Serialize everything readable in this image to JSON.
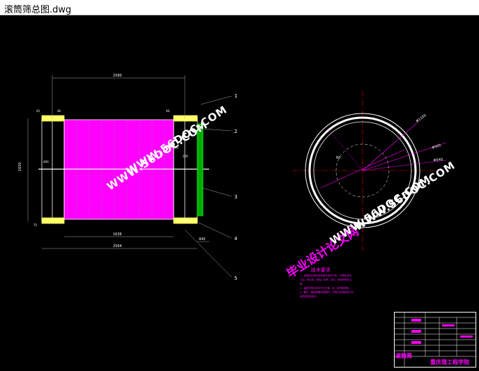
{
  "window": {
    "title": "滚筒筛总图.dwg"
  },
  "drawing": {
    "dims": {
      "top_length": "2580",
      "height": "1650",
      "inner_length": "1636",
      "overall_length": "2564",
      "right_offset": "440",
      "small_left": "46",
      "small_right": "46",
      "flange": "45",
      "left_bottom": "75",
      "mid_right": "270",
      "mid_right2": "200",
      "mid_left": "400",
      "right_side": "100"
    },
    "leaders": [
      "1",
      "2",
      "3",
      "4",
      "5"
    ],
    "section": {
      "r1": "Φ1100",
      "r2": "Φ565",
      "r3": "Φ540",
      "r4": "60"
    },
    "tech_requirements": {
      "heading": "技术要求",
      "lines": [
        "1、装配前应将所有零部件清洗干净，不得有毛刺、飞边、氧化皮、锈蚀、切屑、油污、着色剂和灰尘等。",
        "2、装配过程中零件不允许磕、碰、划伤和锈蚀。",
        "3、螺钉、螺栓和螺母紧固时，严禁打击或使用不合适的旋具和扳手。"
      ]
    },
    "title_block": {
      "school": "重庆理工程学院",
      "name": "滚筒筛"
    }
  },
  "watermarks": {
    "text_cn": "毕业设计论文网",
    "text_en": "WWW.56DOC.COM"
  },
  "colors": {
    "background": "#000000",
    "magenta": "#ff00ff",
    "yellow": "#ffff66",
    "green": "#00ff00",
    "red": "#ff0000"
  }
}
